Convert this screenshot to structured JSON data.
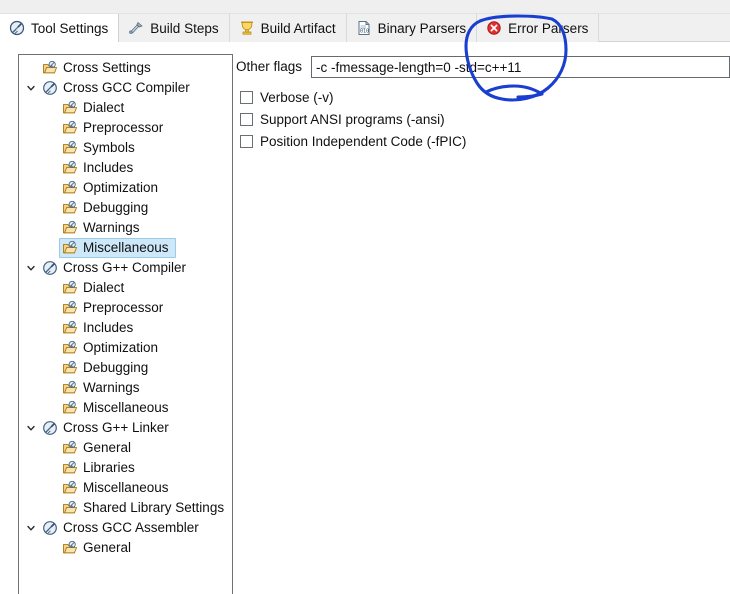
{
  "window": {
    "title": "Tool Settings"
  },
  "tabs": [
    {
      "label": "Tool Settings",
      "icon": "tool-settings-icon",
      "selected": true
    },
    {
      "label": "Build Steps",
      "icon": "build-steps-icon",
      "selected": false
    },
    {
      "label": "Build Artifact",
      "icon": "build-artifact-icon",
      "selected": false
    },
    {
      "label": "Binary Parsers",
      "icon": "binary-parsers-icon",
      "selected": false
    },
    {
      "label": "Error Parsers",
      "icon": "error-parsers-icon",
      "selected": false
    }
  ],
  "tree": [
    {
      "label": "Cross Settings",
      "depth": 1,
      "icon": "folder-tool-icon",
      "twisty": "",
      "selected": false
    },
    {
      "label": "Cross GCC Compiler",
      "depth": 1,
      "icon": "compiler-disc-icon",
      "twisty": "down",
      "selected": false
    },
    {
      "label": "Dialect",
      "depth": 2,
      "icon": "folder-tool-icon",
      "twisty": "",
      "selected": false
    },
    {
      "label": "Preprocessor",
      "depth": 2,
      "icon": "folder-tool-icon",
      "twisty": "",
      "selected": false
    },
    {
      "label": "Symbols",
      "depth": 2,
      "icon": "folder-tool-icon",
      "twisty": "",
      "selected": false
    },
    {
      "label": "Includes",
      "depth": 2,
      "icon": "folder-tool-icon",
      "twisty": "",
      "selected": false
    },
    {
      "label": "Optimization",
      "depth": 2,
      "icon": "folder-tool-icon",
      "twisty": "",
      "selected": false
    },
    {
      "label": "Debugging",
      "depth": 2,
      "icon": "folder-tool-icon",
      "twisty": "",
      "selected": false
    },
    {
      "label": "Warnings",
      "depth": 2,
      "icon": "folder-tool-icon",
      "twisty": "",
      "selected": false
    },
    {
      "label": "Miscellaneous",
      "depth": 2,
      "icon": "folder-tool-icon",
      "twisty": "",
      "selected": true
    },
    {
      "label": "Cross G++ Compiler",
      "depth": 1,
      "icon": "compiler-disc-icon",
      "twisty": "down",
      "selected": false
    },
    {
      "label": "Dialect",
      "depth": 2,
      "icon": "folder-tool-icon",
      "twisty": "",
      "selected": false
    },
    {
      "label": "Preprocessor",
      "depth": 2,
      "icon": "folder-tool-icon",
      "twisty": "",
      "selected": false
    },
    {
      "label": "Includes",
      "depth": 2,
      "icon": "folder-tool-icon",
      "twisty": "",
      "selected": false
    },
    {
      "label": "Optimization",
      "depth": 2,
      "icon": "folder-tool-icon",
      "twisty": "",
      "selected": false
    },
    {
      "label": "Debugging",
      "depth": 2,
      "icon": "folder-tool-icon",
      "twisty": "",
      "selected": false
    },
    {
      "label": "Warnings",
      "depth": 2,
      "icon": "folder-tool-icon",
      "twisty": "",
      "selected": false
    },
    {
      "label": "Miscellaneous",
      "depth": 2,
      "icon": "folder-tool-icon",
      "twisty": "",
      "selected": false
    },
    {
      "label": "Cross G++ Linker",
      "depth": 1,
      "icon": "compiler-disc-icon",
      "twisty": "down",
      "selected": false
    },
    {
      "label": "General",
      "depth": 2,
      "icon": "folder-tool-icon",
      "twisty": "",
      "selected": false
    },
    {
      "label": "Libraries",
      "depth": 2,
      "icon": "folder-tool-icon",
      "twisty": "",
      "selected": false
    },
    {
      "label": "Miscellaneous",
      "depth": 2,
      "icon": "folder-tool-icon",
      "twisty": "",
      "selected": false
    },
    {
      "label": "Shared Library Settings",
      "depth": 2,
      "icon": "folder-tool-icon",
      "twisty": "",
      "selected": false
    },
    {
      "label": "Cross GCC Assembler",
      "depth": 1,
      "icon": "compiler-disc-icon",
      "twisty": "down",
      "selected": false
    },
    {
      "label": "General",
      "depth": 2,
      "icon": "folder-tool-icon",
      "twisty": "",
      "selected": false
    }
  ],
  "settings": {
    "other_flags_label": "Other flags",
    "other_flags_value": "-c -fmessage-length=0 -std=c++11",
    "other_flags_placeholder": "",
    "checkboxes": [
      {
        "label": "Verbose (-v)",
        "checked": false
      },
      {
        "label": "Support ANSI programs (-ansi)",
        "checked": false
      },
      {
        "label": "Position Independent Code (-fPIC)",
        "checked": false
      }
    ]
  },
  "annotation": {
    "name": "hand-drawn-circle",
    "color": "#1a3fd0",
    "highlights": "-std=c++11"
  },
  "colors": {
    "selection_fill": "#cde8f8",
    "selection_border": "#9ec9e2",
    "tab_bar": "#f0f0f0",
    "folder_icon": "#e8b96a",
    "disc_icon": "#5b7fa6",
    "annotation": "#1a3fd0"
  }
}
